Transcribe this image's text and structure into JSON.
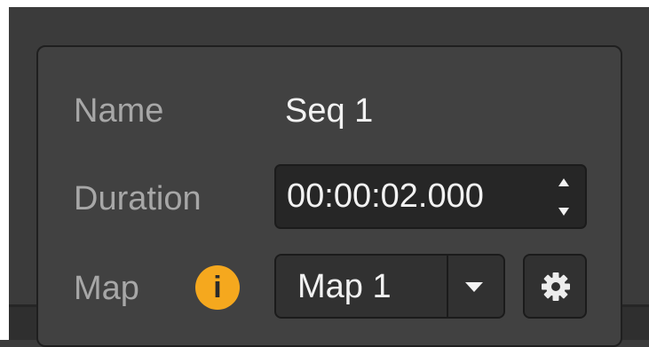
{
  "sequence_panel": {
    "name_label": "Name",
    "name_value": "Seq 1",
    "duration_label": "Duration",
    "duration_value": "00:00:02.000",
    "map_label": "Map",
    "info_badge_glyph": "i",
    "map_select": {
      "selected": "Map 1"
    }
  },
  "icons": {
    "stepper": "stepper-arrows-icon",
    "dropdown": "chevron-down-icon",
    "settings": "gear-icon",
    "info": "info-icon"
  },
  "colors": {
    "info_badge": "#f5a81e",
    "panel_bg": "#414141",
    "field_bg": "#262626",
    "label_text": "#a7a7a7",
    "value_text": "#f2f2f2"
  }
}
